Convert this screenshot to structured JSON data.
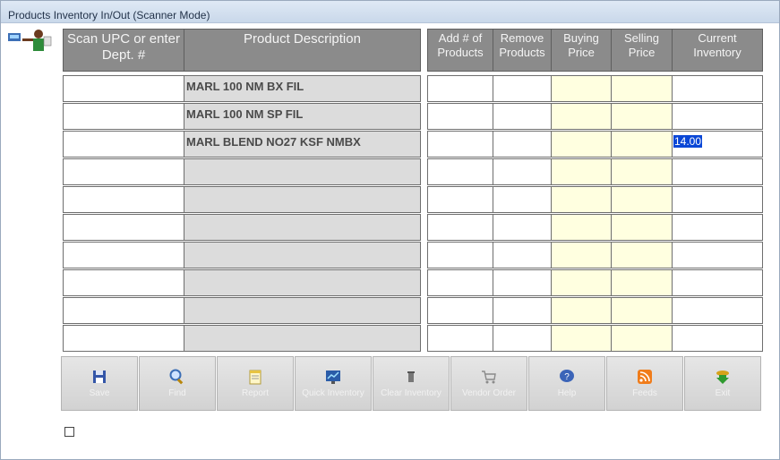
{
  "window": {
    "title": "Products Inventory In/Out (Scanner Mode)"
  },
  "headers": {
    "upc": "Scan UPC or enter Dept. #",
    "desc": "Product Description",
    "add": "Add # of Products",
    "remove": "Remove Products",
    "buying": "Buying Price",
    "selling": "Selling Price",
    "current": "Current Inventory"
  },
  "rows": [
    {
      "upc": "",
      "desc": "MARL 100 NM BX FIL",
      "add": "",
      "remove": "",
      "buying": "",
      "selling": "",
      "current": ""
    },
    {
      "upc": "",
      "desc": "MARL 100 NM SP FIL",
      "add": "",
      "remove": "",
      "buying": "",
      "selling": "",
      "current": ""
    },
    {
      "upc": "",
      "desc": "MARL BLEND NO27 KSF NMBX",
      "add": "",
      "remove": "",
      "buying": "",
      "selling": "",
      "current": "14.00"
    },
    {
      "upc": "",
      "desc": "",
      "add": "",
      "remove": "",
      "buying": "",
      "selling": "",
      "current": ""
    },
    {
      "upc": "",
      "desc": "",
      "add": "",
      "remove": "",
      "buying": "",
      "selling": "",
      "current": ""
    },
    {
      "upc": "",
      "desc": "",
      "add": "",
      "remove": "",
      "buying": "",
      "selling": "",
      "current": ""
    },
    {
      "upc": "",
      "desc": "",
      "add": "",
      "remove": "",
      "buying": "",
      "selling": "",
      "current": ""
    },
    {
      "upc": "",
      "desc": "",
      "add": "",
      "remove": "",
      "buying": "",
      "selling": "",
      "current": ""
    },
    {
      "upc": "",
      "desc": "",
      "add": "",
      "remove": "",
      "buying": "",
      "selling": "",
      "current": ""
    },
    {
      "upc": "",
      "desc": "",
      "add": "",
      "remove": "",
      "buying": "",
      "selling": "",
      "current": ""
    }
  ],
  "buttons": [
    {
      "name": "save",
      "label": "Save",
      "icon": "floppy-disk-icon"
    },
    {
      "name": "find",
      "label": "Find",
      "icon": "magnifier-icon"
    },
    {
      "name": "report",
      "label": "Report",
      "icon": "notepad-icon"
    },
    {
      "name": "quick-inventory",
      "label": "Quick Inventory",
      "icon": "chart-screen-icon"
    },
    {
      "name": "clear",
      "label": "Clear Inventory",
      "icon": "trash-icon"
    },
    {
      "name": "vendor-order",
      "label": "Vendor Order",
      "icon": "cart-icon"
    },
    {
      "name": "help",
      "label": "Help",
      "icon": "help-bubble-icon"
    },
    {
      "name": "feeds",
      "label": "Feeds",
      "icon": "rss-icon"
    },
    {
      "name": "exit",
      "label": "Exit",
      "icon": "exit-arrow-icon"
    }
  ],
  "colors": {
    "header": "#8b8b8b",
    "desc": "#dcdcdc",
    "price": "#ffffe0",
    "selection": "#0a47d6"
  }
}
